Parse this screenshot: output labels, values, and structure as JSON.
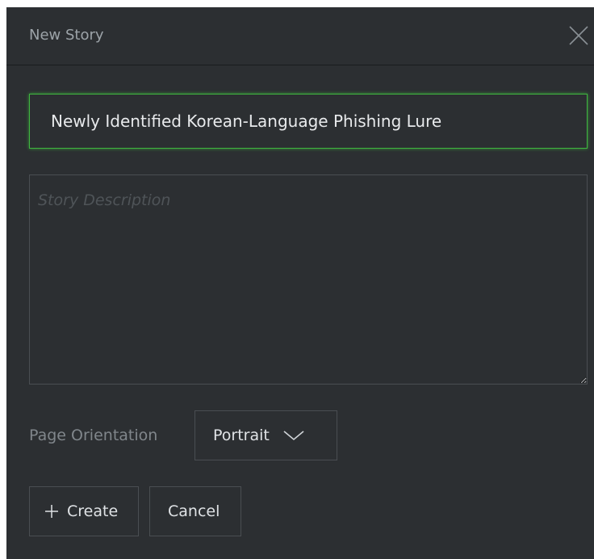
{
  "dialog": {
    "title": "New Story",
    "close_icon": "close-icon"
  },
  "form": {
    "title_value": "Newly Identified Korean-Language Phishing Lure",
    "description_value": "",
    "description_placeholder": "Story Description",
    "orientation_label": "Page Orientation",
    "orientation_value": "Portrait",
    "orientation_icon": "chevron-down-icon"
  },
  "actions": {
    "create_icon": "plus-icon",
    "create_label": "Create",
    "cancel_label": "Cancel"
  },
  "colors": {
    "background": "#2c2f32",
    "focus_border": "#3fb63f",
    "text": "#e8eaec",
    "muted_text": "#80868b"
  }
}
